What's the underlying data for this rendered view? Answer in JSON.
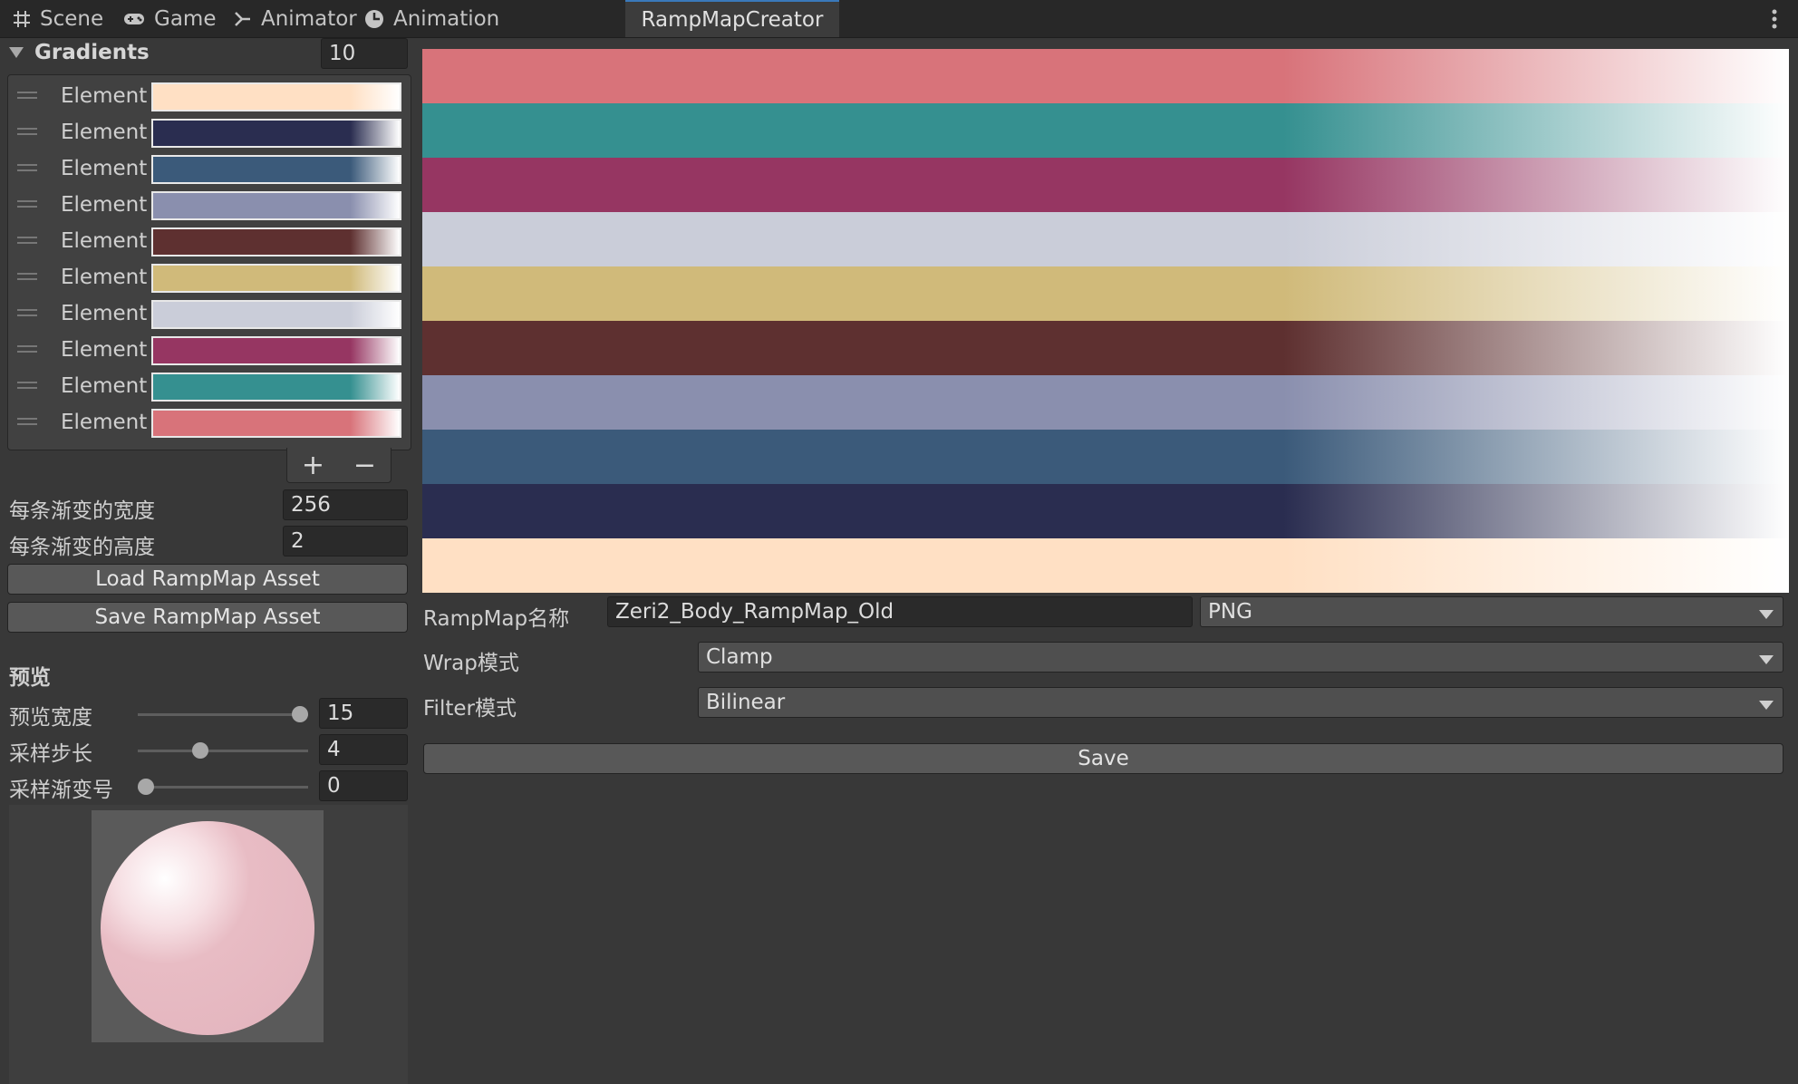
{
  "tabs": [
    {
      "label": "Scene",
      "icon": "grid-icon"
    },
    {
      "label": "Game",
      "icon": "gamepad-icon"
    },
    {
      "label": "Animator",
      "icon": "animator-icon"
    },
    {
      "label": "Animation",
      "icon": "clock-icon"
    },
    {
      "label": "RampMapCreator",
      "icon": ""
    }
  ],
  "gradients": {
    "title": "Gradients",
    "count": "10",
    "element_label": "Element",
    "items": [
      {
        "color": "#ffe0c4",
        "end": "#ffffff"
      },
      {
        "color": "#2a2d50",
        "end": "#ffffff"
      },
      {
        "color": "#3b5a7a",
        "end": "#ffffff"
      },
      {
        "color": "#8a8fae",
        "end": "#ffffff"
      },
      {
        "color": "#5e3030",
        "end": "#ffffff"
      },
      {
        "color": "#d0ba7a",
        "end": "#ffffff"
      },
      {
        "color": "#cacdd9",
        "end": "#ffffff"
      },
      {
        "color": "#963662",
        "end": "#ffffff"
      },
      {
        "color": "#359090",
        "end": "#ffffff"
      },
      {
        "color": "#d8737a",
        "end": "#ffffff"
      }
    ],
    "add_label": "+",
    "remove_label": "−"
  },
  "settings": {
    "width_label": "每条渐变的宽度",
    "width_value": "256",
    "height_label": "每条渐变的高度",
    "height_value": "2",
    "load_label": "Load RampMap Asset",
    "save_asset_label": "Save RampMap Asset"
  },
  "preview": {
    "title": "预览",
    "sliders": [
      {
        "label": "预览宽度",
        "value": "15",
        "fraction": 1.0
      },
      {
        "label": "采样步长",
        "value": "4",
        "fraction": 0.35
      },
      {
        "label": "采样渐变号",
        "value": "0",
        "fraction": 0.0
      }
    ],
    "sphere_color": "#e8bcc4"
  },
  "ramp_rows": [
    "#d8737a",
    "#359090",
    "#963662",
    "#cacdd9",
    "#d0ba7a",
    "#5e3030",
    "#8a8fae",
    "#3b5a7a",
    "#2a2d50",
    "#ffe0c4"
  ],
  "output": {
    "name_label": "RampMap名称",
    "name_value": "Zeri2_Body_RampMap_Old",
    "format_value": "PNG",
    "wrap_label": "Wrap模式",
    "wrap_value": "Clamp",
    "filter_label": "Filter模式",
    "filter_value": "Bilinear",
    "save_label": "Save"
  }
}
